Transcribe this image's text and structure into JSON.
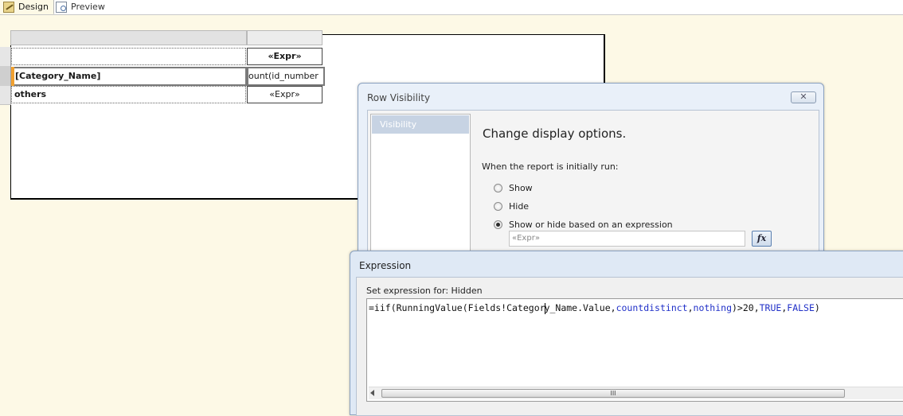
{
  "tabs": [
    {
      "label": "Design",
      "icon": "design-icon",
      "active": true
    },
    {
      "label": "Preview",
      "icon": "preview-icon",
      "active": false
    }
  ],
  "tablix": {
    "header_row": {
      "left": "",
      "right": "«Expr»"
    },
    "category_row": {
      "left": "[Category_Name]",
      "right": "ount(id_number"
    },
    "others_row": {
      "left": "others",
      "right": "«Expr»"
    }
  },
  "row_visibility_dialog": {
    "title": "Row Visibility",
    "close_icon": "close-icon",
    "nav_items": [
      "Visibility"
    ],
    "heading": "Change display options.",
    "subheading": "When the report is initially run:",
    "options": [
      {
        "label": "Show",
        "checked": false
      },
      {
        "label": "Hide",
        "checked": false
      },
      {
        "label": "Show or hide based on an expression",
        "checked": true
      }
    ],
    "expression_field": "«Expr»",
    "fx_button": "fx"
  },
  "expression_dialog": {
    "title": "Expression",
    "label": "Set expression for: Hidden",
    "code": {
      "p1": "=iif(RunningValue(Fields!Categor",
      "p2": "y_Name.Value,",
      "kw1": "countdistinct",
      "sep1": ",",
      "kw2": "nothing",
      "p3": ")>20,",
      "kw3": "TRUE",
      "sep2": ",",
      "kw4": "FALSE",
      "p4": ")"
    },
    "scroll_thumb": "III"
  },
  "colors": {
    "canvas": "#fdf9e6",
    "dialog_frame": "#e9f0f9",
    "keyword": "#2030c8",
    "selected_nav": "#c7d3e3",
    "row_marker": "#f0a030"
  }
}
